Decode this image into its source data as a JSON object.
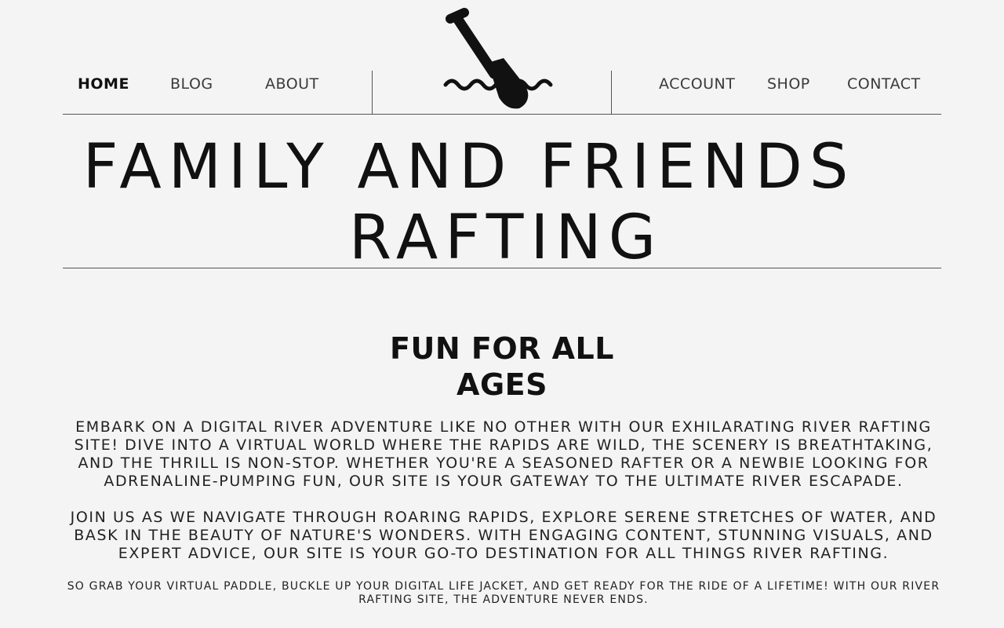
{
  "nav": {
    "left": [
      {
        "label": "HOME",
        "active": true
      },
      {
        "label": "BLOG",
        "active": false
      },
      {
        "label": "ABOUT",
        "active": false
      }
    ],
    "right": [
      {
        "label": "ACCOUNT",
        "active": false
      },
      {
        "label": "SHOP",
        "active": false
      },
      {
        "label": "CONTACT",
        "active": false
      }
    ],
    "logo_icon": "paddle-waves-icon"
  },
  "hero": {
    "title_line1": "FAMILY AND FRIENDS",
    "title_line2": "RAFTING"
  },
  "section": {
    "heading_line1": "FUN FOR ALL",
    "heading_line2": "AGES",
    "paragraph1": "EMBARK ON A DIGITAL RIVER ADVENTURE LIKE NO OTHER WITH OUR EXHILARATING RIVER RAFTING SITE! DIVE INTO A VIRTUAL WORLD WHERE THE RAPIDS ARE WILD, THE SCENERY IS BREATHTAKING, AND THE THRILL IS NON-STOP. WHETHER YOU'RE A SEASONED RAFTER OR A NEWBIE LOOKING FOR ADRENALINE-PUMPING FUN, OUR SITE IS YOUR GATEWAY TO THE ULTIMATE RIVER ESCAPADE.",
    "paragraph2": "JOIN US AS WE NAVIGATE THROUGH ROARING RAPIDS, EXPLORE SERENE STRETCHES OF WATER, AND BASK IN THE BEAUTY OF NATURE'S WONDERS. WITH ENGAGING CONTENT, STUNNING VISUALS, AND EXPERT ADVICE, OUR SITE IS YOUR GO-TO DESTINATION FOR ALL THINGS RIVER RAFTING.",
    "paragraph3": "SO GRAB YOUR VIRTUAL PADDLE, BUCKLE UP YOUR DIGITAL LIFE JACKET, AND GET READY FOR THE RIDE OF A LIFETIME! WITH OUR RIVER RAFTING SITE, THE ADVENTURE NEVER ENDS."
  },
  "colors": {
    "background": "#f4f4f4",
    "text": "#111111",
    "rule": "#555555"
  }
}
